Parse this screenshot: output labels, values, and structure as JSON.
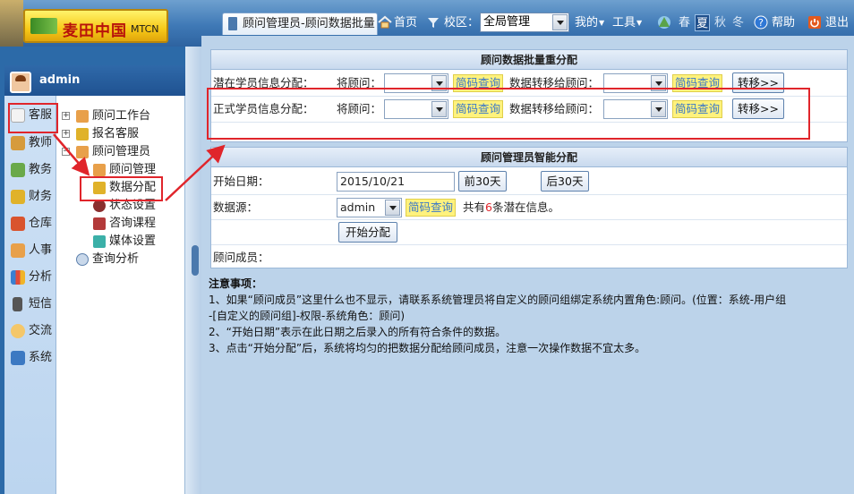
{
  "header": {
    "logo_cn": "麦田中国",
    "logo_en": "MTCN",
    "active_tab": "顾问管理员-顾问数据批量",
    "home": "首页",
    "campus_label": "校区：",
    "campus_value": "全局管理",
    "mine": "我的",
    "tools": "工具",
    "seasons": [
      "春",
      "夏",
      "秋",
      "冬"
    ],
    "help": "帮助",
    "logout": "退出"
  },
  "user": {
    "name": "admin"
  },
  "sidebar": {
    "items": [
      {
        "label": "客服",
        "icon": "document-icon"
      },
      {
        "label": "教师",
        "icon": "book-icon"
      },
      {
        "label": "教务",
        "icon": "people-icon"
      },
      {
        "label": "财务",
        "icon": "money-icon"
      },
      {
        "label": "仓库",
        "icon": "house-icon"
      },
      {
        "label": "人事",
        "icon": "person-icon"
      },
      {
        "label": "分析",
        "icon": "bar-chart-icon"
      },
      {
        "label": "短信",
        "icon": "phone-icon"
      },
      {
        "label": "交流",
        "icon": "chat-icon"
      },
      {
        "label": "系统",
        "icon": "system-icon"
      }
    ]
  },
  "tree": {
    "nodes": [
      {
        "label": "顾问工作台"
      },
      {
        "label": "报名客服"
      },
      {
        "label": "顾问管理员"
      },
      {
        "label": "顾问管理"
      },
      {
        "label": "数据分配"
      },
      {
        "label": "状态设置"
      },
      {
        "label": "咨询课程"
      },
      {
        "label": "媒体设置"
      },
      {
        "label": "查询分析"
      }
    ]
  },
  "batch_panel": {
    "title": "顾问数据批量重分配",
    "rows": [
      {
        "label": "潜在学员信息分配：",
        "from_label": "将顾问：",
        "query": "简码查询",
        "to_label": "数据转移给顾问：",
        "button": "转移>>"
      },
      {
        "label": "正式学员信息分配：",
        "from_label": "将顾问：",
        "query": "简码查询",
        "to_label": "数据转移给顾问：",
        "button": "转移>>"
      }
    ]
  },
  "smart_panel": {
    "title": "顾问管理员智能分配",
    "start_date_label": "开始日期：",
    "start_date_value": "2015/10/21",
    "prev_button": "前30天",
    "next_button": "后30天",
    "source_label": "数据源：",
    "source_value": "admin",
    "query": "简码查询",
    "count_prefix": "共有",
    "count": "6",
    "count_suffix": "条潜在信息。",
    "start_button": "开始分配",
    "members_label": "顾问成员："
  },
  "notes": {
    "heading": "注意事项：",
    "lines": [
      "1、如果“顾问成员”这里什么也不显示，请联系系统管理员将自定义的顾问组绑定系统内置角色:顾问。(位置：系统-用户组",
      "-[自定义的顾问组]-权限-系统角色：顾问)",
      "2、“开始日期”表示在此日期之后录入的所有符合条件的数据。",
      "3、点击“开始分配”后，系统将均匀的把数据分配给顾问成员，注意一次操作数据不宜太多。"
    ]
  },
  "colors": {
    "highlight": "#e0252b",
    "count": "#e0252b",
    "query_bg": "#fff27d"
  }
}
